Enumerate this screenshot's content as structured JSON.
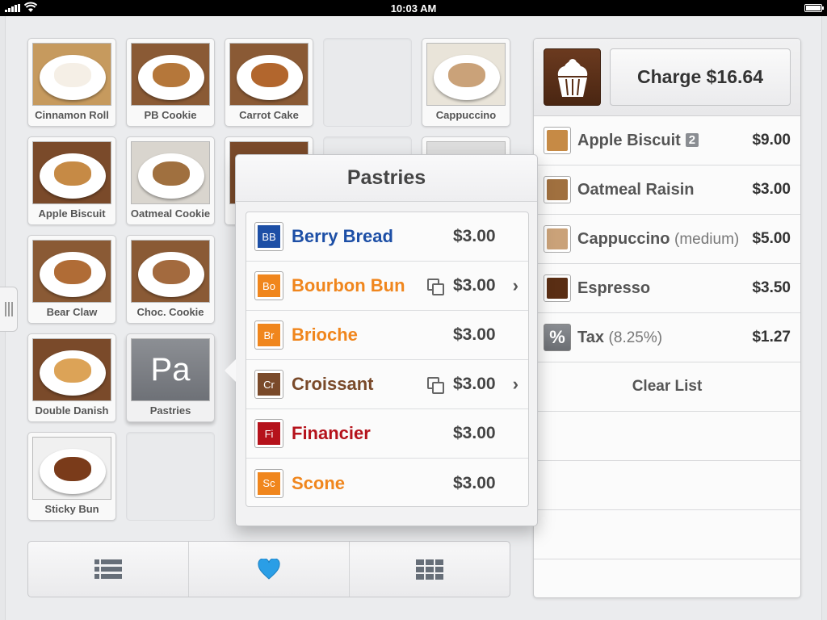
{
  "status_bar": {
    "time": "10:03 AM"
  },
  "tiles": [
    {
      "label": "Cinnamon Roll",
      "bg": "#c69a5e",
      "food": "#f5efe6"
    },
    {
      "label": "PB Cookie",
      "bg": "#8a5a35",
      "food": "#b5773a"
    },
    {
      "label": "Carrot Cake",
      "bg": "#8a5a35",
      "food": "#b2662d"
    },
    {
      "label": "Cappuccino",
      "bg": "#e9e4d9",
      "food": "#caa279"
    },
    {
      "label": "Apple Biscuit",
      "bg": "#7a4a2a",
      "food": "#c68a45"
    },
    {
      "label": "Oatmeal Cookie",
      "bg": "#d9d5ce",
      "food": "#a0703f"
    },
    {
      "label": "Bear Claw",
      "bg": "#8a5a35",
      "food": "#b06c36"
    },
    {
      "label": "Choc. Cookie",
      "bg": "#8a5a35",
      "food": "#a36a3e"
    },
    {
      "label": "Double Danish",
      "bg": "#7a4a2a",
      "food": "#dca357"
    },
    {
      "label": "Sticky Bun",
      "bg": "#f0f0f0",
      "food": "#7a3b1a"
    }
  ],
  "category_tile": {
    "abbr": "Pa",
    "label": "Pastries"
  },
  "popover": {
    "title": "Pastries",
    "items": [
      {
        "abbr": "BB",
        "name": "Berry Bread",
        "price": "$3.00",
        "color": "#1d4fa6",
        "has_options": false
      },
      {
        "abbr": "Bo",
        "name": "Bourbon Bun",
        "price": "$3.00",
        "color": "#f0861d",
        "has_options": true
      },
      {
        "abbr": "Br",
        "name": "Brioche",
        "price": "$3.00",
        "color": "#f0861d",
        "has_options": false
      },
      {
        "abbr": "Cr",
        "name": "Croissant",
        "price": "$3.00",
        "color": "#7a4a2a",
        "has_options": true
      },
      {
        "abbr": "Fi",
        "name": "Financier",
        "price": "$3.00",
        "color": "#b5121b",
        "has_options": false
      },
      {
        "abbr": "Sc",
        "name": "Scone",
        "price": "$3.00",
        "color": "#f0861d",
        "has_options": false
      }
    ]
  },
  "order": {
    "charge_label": "Charge $16.64",
    "items": [
      {
        "name": "Apple Biscuit",
        "qty": "2",
        "sub": "",
        "price": "$9.00",
        "thumb": "#c68a45"
      },
      {
        "name": "Oatmeal Raisin",
        "qty": "",
        "sub": "",
        "price": "$3.00",
        "thumb": "#a0703f"
      },
      {
        "name": "Cappuccino",
        "qty": "",
        "sub": "(medium)",
        "price": "$5.00",
        "thumb": "#caa279"
      },
      {
        "name": "Espresso",
        "qty": "",
        "sub": "",
        "price": "$3.50",
        "thumb": "#5a2e14"
      }
    ],
    "tax": {
      "symbol": "%",
      "name": "Tax",
      "sub": "(8.25%)",
      "price": "$1.27"
    },
    "clear_label": "Clear List"
  },
  "toolbar": {
    "icons": [
      "list-icon",
      "heart-icon",
      "grid-icon"
    ]
  }
}
